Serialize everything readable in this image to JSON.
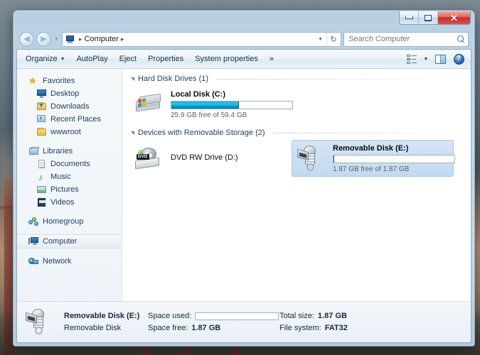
{
  "window": {
    "minimize_label": "Minimize",
    "maximize_label": "Maximize",
    "close_label": "✕"
  },
  "nav": {
    "back_glyph": "◀",
    "forward_glyph": "▶",
    "history_caret": "▼",
    "breadcrumb": {
      "icon": "computer-icon",
      "leading_sep": "▸",
      "root": "Computer",
      "trailing_sep": "▸"
    },
    "address_caret": "▼",
    "refresh_glyph": "↻"
  },
  "search": {
    "placeholder": "Search Computer",
    "value": ""
  },
  "toolbar": {
    "items": [
      {
        "label": "Organize",
        "has_caret": true
      },
      {
        "label": "AutoPlay",
        "has_caret": false
      },
      {
        "label": "Eject",
        "has_caret": false
      },
      {
        "label": "Properties",
        "has_caret": false
      },
      {
        "label": "System properties",
        "has_caret": false
      },
      {
        "label": "»",
        "has_caret": false
      }
    ],
    "caret": "▼",
    "views_caret": "▼",
    "help_glyph": "?"
  },
  "sidebar": {
    "groups": [
      {
        "header": {
          "label": "Favorites",
          "icon": "star-icon"
        },
        "items": [
          {
            "label": "Desktop",
            "icon": "desktop-icon"
          },
          {
            "label": "Downloads",
            "icon": "downloads-folder-icon"
          },
          {
            "label": "Recent Places",
            "icon": "recent-places-icon"
          },
          {
            "label": "wwwroot",
            "icon": "folder-icon"
          }
        ]
      },
      {
        "header": {
          "label": "Libraries",
          "icon": "libraries-icon"
        },
        "items": [
          {
            "label": "Documents",
            "icon": "document-icon"
          },
          {
            "label": "Music",
            "icon": "music-note-icon"
          },
          {
            "label": "Pictures",
            "icon": "picture-icon"
          },
          {
            "label": "Videos",
            "icon": "video-icon"
          }
        ]
      },
      {
        "header": {
          "label": "Homegroup",
          "icon": "homegroup-icon"
        },
        "items": []
      },
      {
        "header": {
          "label": "Computer",
          "icon": "computer-icon",
          "selected": true
        },
        "items": []
      },
      {
        "header": {
          "label": "Network",
          "icon": "network-icon"
        },
        "items": []
      }
    ]
  },
  "content": {
    "groups": [
      {
        "title": "Hard Disk Drives (1)",
        "drives": [
          {
            "name": "Local Disk (C:)",
            "icon": "hard-disk-icon",
            "has_bar": true,
            "used_percent": 56,
            "capacity_text": "25.9 GB free of 59.4 GB",
            "selected": false
          }
        ]
      },
      {
        "title": "Devices with Removable Storage (2)",
        "drives": [
          {
            "name": "DVD RW Drive (D:)",
            "icon": "dvd-drive-icon",
            "has_bar": false,
            "used_percent": 0,
            "capacity_text": "",
            "selected": false
          },
          {
            "name": "Removable Disk (E:)",
            "icon": "usb-drive-icon",
            "has_bar": true,
            "used_percent": 0,
            "capacity_text": "1.87 GB free of 1.87 GB",
            "selected": true
          }
        ]
      }
    ]
  },
  "status": {
    "icon": "usb-drive-icon",
    "name": "Removable Disk (E:)",
    "type": "Removable Disk",
    "space_used_label": "Space used:",
    "space_used_percent": 0,
    "space_free_label": "Space free:",
    "space_free_value": "1.87 GB",
    "total_size_label": "Total size:",
    "total_size_value": "1.87 GB",
    "file_system_label": "File system:",
    "file_system_value": "FAT32"
  },
  "colors": {
    "disk_bar_blue": "#12cdf2",
    "selection_blue": "#c2daf1",
    "close_button_red": "#c5302a",
    "accent_text": "#15293c"
  }
}
